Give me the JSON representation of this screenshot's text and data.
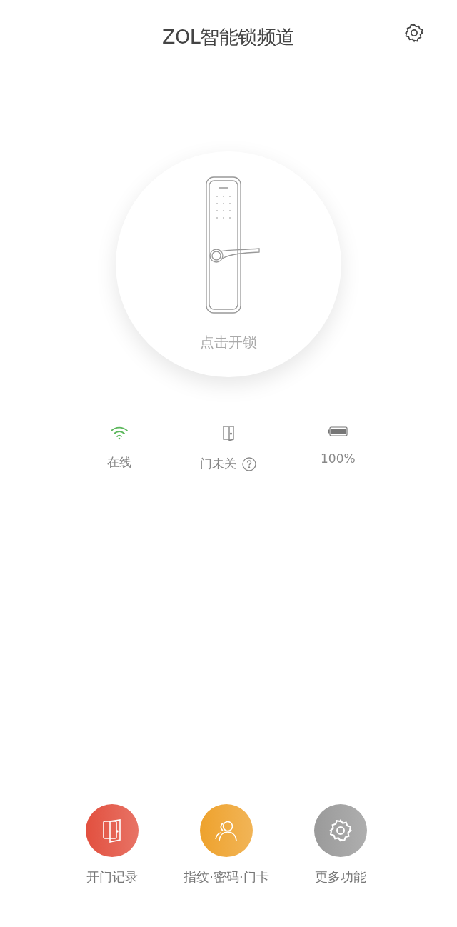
{
  "header": {
    "title": "ZOL智能锁频道"
  },
  "lock": {
    "hint": "点击开锁"
  },
  "status": [
    {
      "kind": "wifi",
      "label": "在线",
      "help": false
    },
    {
      "kind": "door",
      "label": "门未关",
      "help": true
    },
    {
      "kind": "battery",
      "label": "100%",
      "help": false
    }
  ],
  "actions": [
    {
      "kind": "door",
      "label": "开门记录",
      "color": "#e2503f"
    },
    {
      "kind": "people",
      "label": "指纹·密码·门卡",
      "color": "#eea22d"
    },
    {
      "kind": "gear",
      "label": "更多功能",
      "color": "#9a9a9a"
    }
  ]
}
